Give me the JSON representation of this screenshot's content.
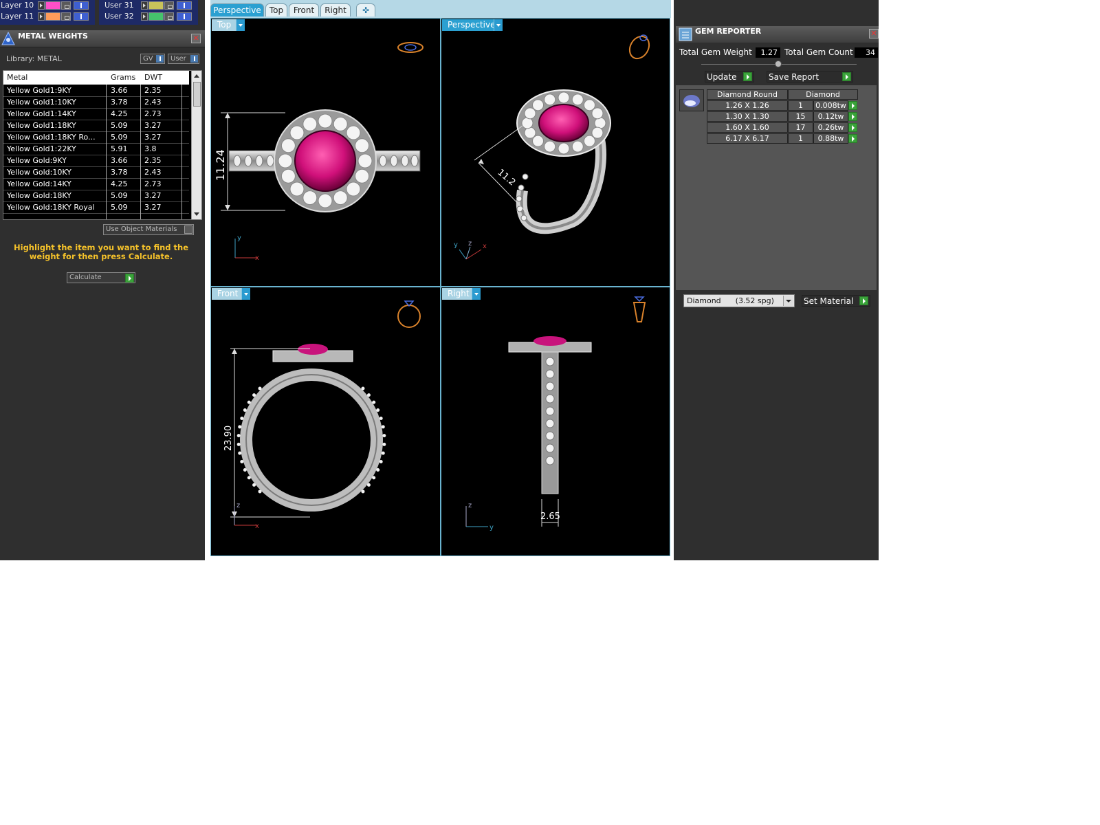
{
  "layers": {
    "left": [
      {
        "label": "Layer 10",
        "color": "#ff4fc8"
      },
      {
        "label": "Layer 11",
        "color": "#ff9c5a"
      }
    ],
    "right": [
      {
        "label": "User 31",
        "color": "#c8c25a"
      },
      {
        "label": "User 32",
        "color": "#45c36c"
      }
    ]
  },
  "metal_weights": {
    "title": "METAL WEIGHTS",
    "library_label": "Library: METAL",
    "gv_label": "GV",
    "user_label": "User",
    "columns": [
      "Metal",
      "Grams",
      "DWT"
    ],
    "rows": [
      [
        "Yellow Gold1:9KY",
        "3.66",
        "2.35"
      ],
      [
        "Yellow Gold1:10KY",
        "3.78",
        "2.43"
      ],
      [
        "Yellow Gold1:14KY",
        "4.25",
        "2.73"
      ],
      [
        "Yellow Gold1:18KY",
        "5.09",
        "3.27"
      ],
      [
        "Yellow Gold1:18KY Ro...",
        "5.09",
        "3.27"
      ],
      [
        "Yellow Gold1:22KY",
        "5.91",
        "3.8"
      ],
      [
        "Yellow Gold:9KY",
        "3.66",
        "2.35"
      ],
      [
        "Yellow Gold:10KY",
        "3.78",
        "2.43"
      ],
      [
        "Yellow Gold:14KY",
        "4.25",
        "2.73"
      ],
      [
        "Yellow Gold:18KY",
        "5.09",
        "3.27"
      ],
      [
        "Yellow Gold:18KY Royal",
        "5.09",
        "3.27"
      ]
    ],
    "use_object_materials": "Use Object Materials",
    "instruction": "Highlight the item you want to find the weight for then press Calculate.",
    "calculate_label": "Calculate"
  },
  "viewport_tabs": [
    "Perspective",
    "Top",
    "Front",
    "Right"
  ],
  "viewports": {
    "top": {
      "label": "Top",
      "dimension": "11.24"
    },
    "perspective": {
      "label": "Perspective",
      "dimension": "11.2"
    },
    "front": {
      "label": "Front",
      "dimension": "23.90"
    },
    "right": {
      "label": "Right",
      "dimension": "2.65"
    }
  },
  "gem_reporter": {
    "title": "GEM REPORTER",
    "total_weight_label": "Total Gem Weight",
    "total_weight_value": "1.27",
    "total_count_label": "Total Gem Count",
    "total_count_value": "34",
    "update_label": "Update",
    "save_report_label": "Save Report",
    "table_header": [
      "Diamond Round",
      "Diamond"
    ],
    "rows": [
      [
        "1.26 X 1.26",
        "1",
        "0.008tw"
      ],
      [
        "1.30 X 1.30",
        "15",
        "0.12tw"
      ],
      [
        "1.60 X 1.60",
        "17",
        "0.26tw"
      ],
      [
        "6.17 X 6.17",
        "1",
        "0.88tw"
      ]
    ],
    "material_select": "Diamond      (3.52 spg)",
    "set_material_label": "Set Material"
  }
}
